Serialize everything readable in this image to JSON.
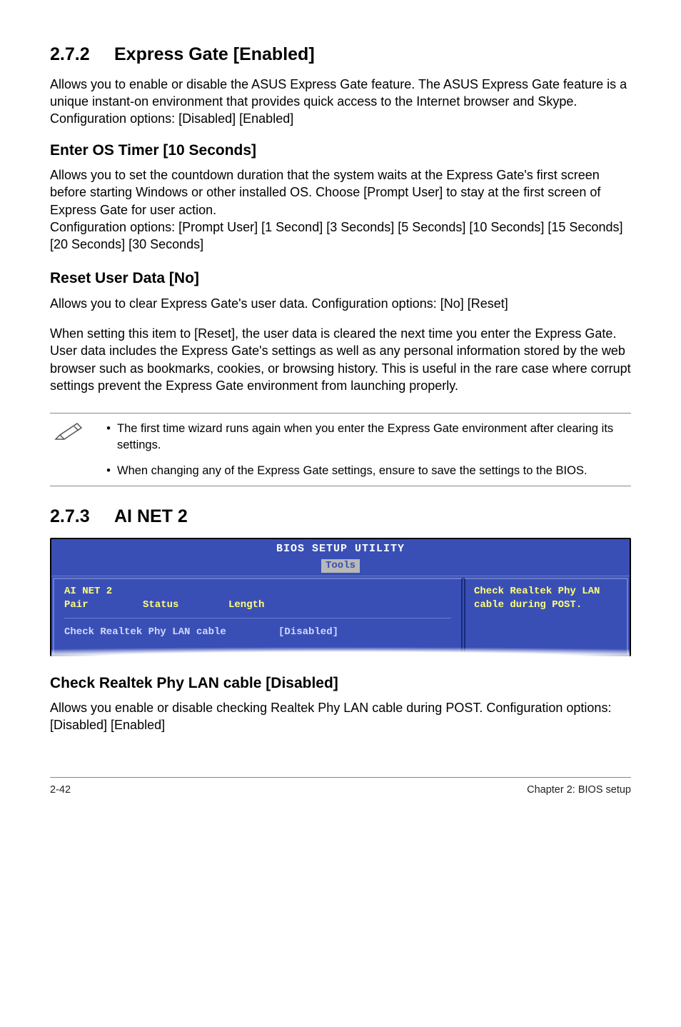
{
  "sec272": {
    "num": "2.7.2",
    "title": "Express Gate [Enabled]",
    "p1": "Allows you to enable or disable the ASUS Express Gate feature. The ASUS Express Gate feature is a unique instant-on environment that provides quick access to the Internet browser and Skype. Configuration options: [Disabled] [Enabled]",
    "sub1_title": "Enter OS Timer [10 Seconds]",
    "sub1_p1": "Allows you to set the countdown duration that the system waits at the Express Gate's first screen before starting Windows or other installed OS. Choose [Prompt User] to stay at the first screen of Express Gate for user action.",
    "sub1_p2": "Configuration options: [Prompt User] [1 Second] [3 Seconds] [5 Seconds] [10 Seconds] [15 Seconds] [20 Seconds] [30 Seconds]",
    "sub2_title": "Reset User Data [No]",
    "sub2_p1": "Allows you to clear Express Gate's user data. Configuration options: [No] [Reset]",
    "sub2_p2": "When setting this item to [Reset], the user data is cleared the next time you enter the Express Gate. User data includes the Express Gate's settings as well as any personal information stored by the web browser such as bookmarks, cookies, or browsing history. This is useful in the rare case where corrupt settings prevent the Express Gate environment from launching properly."
  },
  "notes": {
    "n1": "The first time wizard runs again when you enter the Express Gate environment after clearing its settings.",
    "n2": "When changing any of the Express Gate settings, ensure to save the settings to the BIOS."
  },
  "sec273": {
    "num": "2.7.3",
    "title": "AI NET 2"
  },
  "bios": {
    "title": "BIOS SETUP UTILITY",
    "tab": "Tools",
    "hdr_label": "AI NET 2",
    "col_pair": "Pair",
    "col_status": "Status",
    "col_length": "Length",
    "opt_label": "Check Realtek Phy LAN cable",
    "opt_value": "[Disabled]",
    "help": "Check Realtek Phy LAN cable during POST."
  },
  "sub_check": {
    "title": "Check Realtek Phy LAN cable [Disabled]",
    "p1": "Allows you enable or disable checking Realtek Phy LAN cable during POST. Configuration options: [Disabled] [Enabled]"
  },
  "footer": {
    "left": "2-42",
    "right": "Chapter 2: BIOS setup"
  }
}
